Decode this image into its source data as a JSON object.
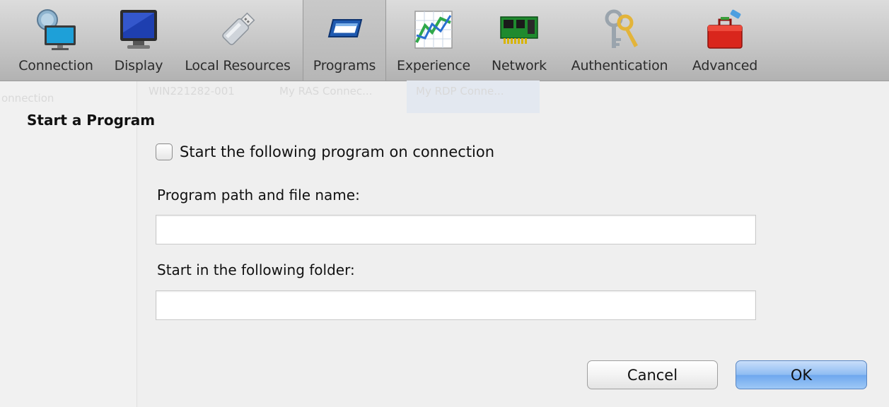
{
  "toolbar": {
    "tabs": [
      {
        "label": "Connection",
        "icon": "connection-icon"
      },
      {
        "label": "Display",
        "icon": "display-icon"
      },
      {
        "label": "Local Resources",
        "icon": "usb-drive-icon"
      },
      {
        "label": "Programs",
        "icon": "program-window-icon",
        "selected": true
      },
      {
        "label": "Experience",
        "icon": "chart-icon"
      },
      {
        "label": "Network",
        "icon": "network-card-icon"
      },
      {
        "label": "Authentication",
        "icon": "keys-icon"
      },
      {
        "label": "Advanced",
        "icon": "toolbox-icon"
      }
    ]
  },
  "background": {
    "left_text": "onnection",
    "items": [
      "WIN221282-001",
      "My RAS Connec...",
      "My RDP Conne..."
    ]
  },
  "form": {
    "section_title": "Start a Program",
    "checkbox_label": "Start the following program on connection",
    "checkbox_checked": false,
    "program_path_label": "Program path and file name:",
    "program_path_value": "",
    "start_folder_label": "Start in the following folder:",
    "start_folder_value": ""
  },
  "buttons": {
    "cancel": "Cancel",
    "ok": "OK"
  },
  "colors": {
    "ok_button": "#8ebcf2",
    "toolbar": "#c6c6c6"
  }
}
